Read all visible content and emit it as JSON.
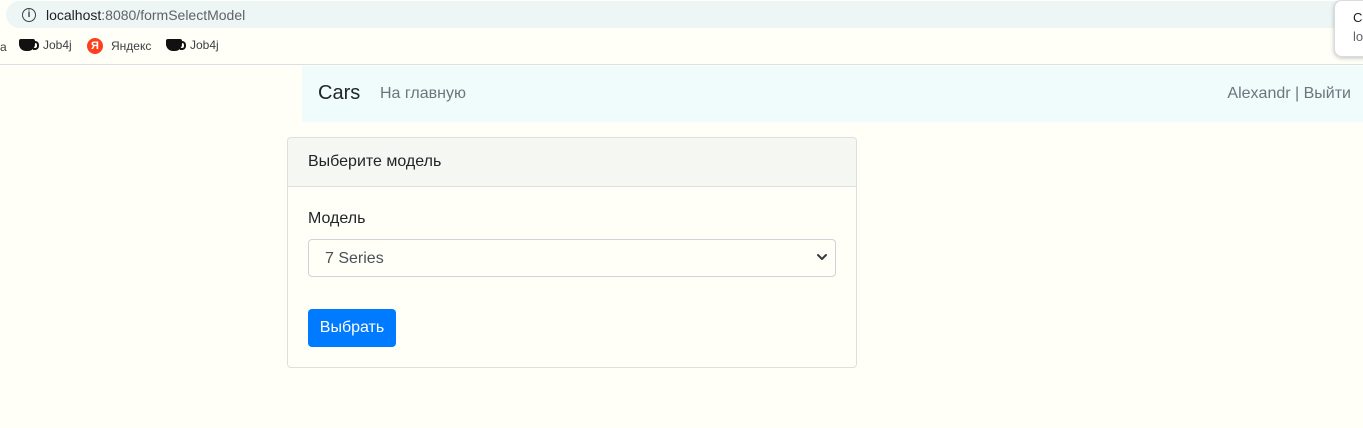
{
  "browser": {
    "url_host": "localhost",
    "url_rest": ":8080/formSelectModel",
    "popup_line1": "C",
    "popup_line2": "lo",
    "bookmark_edge": "а",
    "bookmarks": [
      {
        "label": "Job4j",
        "icon": "coffee-cup-icon"
      },
      {
        "label": "Яндекс",
        "icon": "yandex-icon",
        "glyph": "Я"
      },
      {
        "label": "Job4j",
        "icon": "coffee-cup-icon"
      }
    ]
  },
  "navbar": {
    "brand": "Cars",
    "home_link": "На главную",
    "user": "Alexandr | Выйти"
  },
  "card": {
    "title": "Выберите модель",
    "field_label": "Модель",
    "select_value": "7 Series",
    "submit_label": "Выбрать"
  },
  "colors": {
    "primary": "#007bff",
    "page_bg": "#fffff8",
    "navbar_bg": "#f0fbfb"
  }
}
